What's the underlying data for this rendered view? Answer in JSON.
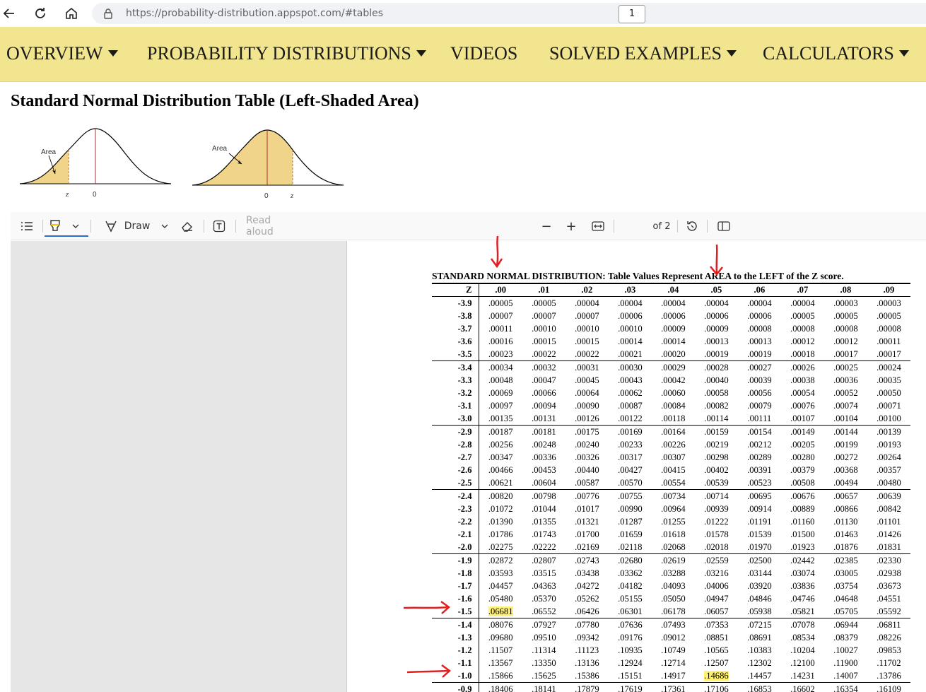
{
  "browser": {
    "url": "https://probability-distribution.appspot.com/#tables",
    "icons": {
      "back": "back-arrow-icon",
      "reload": "reload-icon",
      "home": "home-icon",
      "lock": "lock-icon"
    }
  },
  "nav": {
    "items": [
      {
        "label": "OVERVIEW",
        "dropdown": true
      },
      {
        "label": "PROBABILITY DISTRIBUTIONS",
        "dropdown": true
      },
      {
        "label": "VIDEOS",
        "dropdown": false
      },
      {
        "label": "SOLVED EXAMPLES",
        "dropdown": true
      },
      {
        "label": "CALCULATORS",
        "dropdown": true
      }
    ],
    "bg_color": "#f2e58f"
  },
  "page": {
    "title": "Standard Normal Distribution Table (Left-Shaded Area)"
  },
  "curves": {
    "left": {
      "area_label": "Area",
      "z_label": "z",
      "zero_label": "0"
    },
    "right": {
      "area_label": "Area",
      "z_label": "z",
      "zero_label": "0"
    },
    "fill_color": "#f0d48a"
  },
  "pdf_toolbar": {
    "draw_label": "Draw",
    "read_aloud_label": "Read aloud",
    "page_current": "1",
    "page_total": "of 2",
    "zoom_out": "−",
    "zoom_in": "+"
  },
  "table": {
    "title": "STANDARD NORMAL DISTRIBUTION: Table Values Represent AREA to the LEFT of the Z score.",
    "header": [
      "Z",
      ".00",
      ".01",
      ".02",
      ".03",
      ".04",
      ".05",
      ".06",
      ".07",
      ".08",
      ".09"
    ],
    "rows": [
      [
        "-3.9",
        ".00005",
        ".00005",
        ".00004",
        ".00004",
        ".00004",
        ".00004",
        ".00004",
        ".00004",
        ".00003",
        ".00003"
      ],
      [
        "-3.8",
        ".00007",
        ".00007",
        ".00007",
        ".00006",
        ".00006",
        ".00006",
        ".00006",
        ".00005",
        ".00005",
        ".00005"
      ],
      [
        "-3.7",
        ".00011",
        ".00010",
        ".00010",
        ".00010",
        ".00009",
        ".00009",
        ".00008",
        ".00008",
        ".00008",
        ".00008"
      ],
      [
        "-3.6",
        ".00016",
        ".00015",
        ".00015",
        ".00014",
        ".00014",
        ".00013",
        ".00013",
        ".00012",
        ".00012",
        ".00011"
      ],
      [
        "-3.5",
        ".00023",
        ".00022",
        ".00022",
        ".00021",
        ".00020",
        ".00019",
        ".00019",
        ".00018",
        ".00017",
        ".00017"
      ],
      [
        "-3.4",
        ".00034",
        ".00032",
        ".00031",
        ".00030",
        ".00029",
        ".00028",
        ".00027",
        ".00026",
        ".00025",
        ".00024"
      ],
      [
        "-3.3",
        ".00048",
        ".00047",
        ".00045",
        ".00043",
        ".00042",
        ".00040",
        ".00039",
        ".00038",
        ".00036",
        ".00035"
      ],
      [
        "-3.2",
        ".00069",
        ".00066",
        ".00064",
        ".00062",
        ".00060",
        ".00058",
        ".00056",
        ".00054",
        ".00052",
        ".00050"
      ],
      [
        "-3.1",
        ".00097",
        ".00094",
        ".00090",
        ".00087",
        ".00084",
        ".00082",
        ".00079",
        ".00076",
        ".00074",
        ".00071"
      ],
      [
        "-3.0",
        ".00135",
        ".00131",
        ".00126",
        ".00122",
        ".00118",
        ".00114",
        ".00111",
        ".00107",
        ".00104",
        ".00100"
      ],
      [
        "-2.9",
        ".00187",
        ".00181",
        ".00175",
        ".00169",
        ".00164",
        ".00159",
        ".00154",
        ".00149",
        ".00144",
        ".00139"
      ],
      [
        "-2.8",
        ".00256",
        ".00248",
        ".00240",
        ".00233",
        ".00226",
        ".00219",
        ".00212",
        ".00205",
        ".00199",
        ".00193"
      ],
      [
        "-2.7",
        ".00347",
        ".00336",
        ".00326",
        ".00317",
        ".00307",
        ".00298",
        ".00289",
        ".00280",
        ".00272",
        ".00264"
      ],
      [
        "-2.6",
        ".00466",
        ".00453",
        ".00440",
        ".00427",
        ".00415",
        ".00402",
        ".00391",
        ".00379",
        ".00368",
        ".00357"
      ],
      [
        "-2.5",
        ".00621",
        ".00604",
        ".00587",
        ".00570",
        ".00554",
        ".00539",
        ".00523",
        ".00508",
        ".00494",
        ".00480"
      ],
      [
        "-2.4",
        ".00820",
        ".00798",
        ".00776",
        ".00755",
        ".00734",
        ".00714",
        ".00695",
        ".00676",
        ".00657",
        ".00639"
      ],
      [
        "-2.3",
        ".01072",
        ".01044",
        ".01017",
        ".00990",
        ".00964",
        ".00939",
        ".00914",
        ".00889",
        ".00866",
        ".00842"
      ],
      [
        "-2.2",
        ".01390",
        ".01355",
        ".01321",
        ".01287",
        ".01255",
        ".01222",
        ".01191",
        ".01160",
        ".01130",
        ".01101"
      ],
      [
        "-2.1",
        ".01786",
        ".01743",
        ".01700",
        ".01659",
        ".01618",
        ".01578",
        ".01539",
        ".01500",
        ".01463",
        ".01426"
      ],
      [
        "-2.0",
        ".02275",
        ".02222",
        ".02169",
        ".02118",
        ".02068",
        ".02018",
        ".01970",
        ".01923",
        ".01876",
        ".01831"
      ],
      [
        "-1.9",
        ".02872",
        ".02807",
        ".02743",
        ".02680",
        ".02619",
        ".02559",
        ".02500",
        ".02442",
        ".02385",
        ".02330"
      ],
      [
        "-1.8",
        ".03593",
        ".03515",
        ".03438",
        ".03362",
        ".03288",
        ".03216",
        ".03144",
        ".03074",
        ".03005",
        ".02938"
      ],
      [
        "-1.7",
        ".04457",
        ".04363",
        ".04272",
        ".04182",
        ".04093",
        ".04006",
        ".03920",
        ".03836",
        ".03754",
        ".03673"
      ],
      [
        "-1.6",
        ".05480",
        ".05370",
        ".05262",
        ".05155",
        ".05050",
        ".04947",
        ".04846",
        ".04746",
        ".04648",
        ".04551"
      ],
      [
        "-1.5",
        ".06681",
        ".06552",
        ".06426",
        ".06301",
        ".06178",
        ".06057",
        ".05938",
        ".05821",
        ".05705",
        ".05592"
      ],
      [
        "-1.4",
        ".08076",
        ".07927",
        ".07780",
        ".07636",
        ".07493",
        ".07353",
        ".07215",
        ".07078",
        ".06944",
        ".06811"
      ],
      [
        "-1.3",
        ".09680",
        ".09510",
        ".09342",
        ".09176",
        ".09012",
        ".08851",
        ".08691",
        ".08534",
        ".08379",
        ".08226"
      ],
      [
        "-1.2",
        ".11507",
        ".11314",
        ".11123",
        ".10935",
        ".10749",
        ".10565",
        ".10383",
        ".10204",
        ".10027",
        ".09853"
      ],
      [
        "-1.1",
        ".13567",
        ".13350",
        ".13136",
        ".12924",
        ".12714",
        ".12507",
        ".12302",
        ".12100",
        ".11900",
        ".11702"
      ],
      [
        "-1.0",
        ".15866",
        ".15625",
        ".15386",
        ".15151",
        ".14917",
        ".14686",
        ".14457",
        ".14231",
        ".14007",
        ".13786"
      ],
      [
        "-0.9",
        ".18406",
        ".18141",
        ".17879",
        ".17619",
        ".17361",
        ".17106",
        ".16853",
        ".16602",
        ".16354",
        ".16109"
      ]
    ],
    "highlighted_cells": [
      {
        "row": "-1.5",
        "col": ".00",
        "value": ".06681"
      },
      {
        "row": "-1.0",
        "col": ".05",
        "value": ".14686"
      }
    ],
    "highlight_color": "#fff176"
  },
  "annotations": {
    "color": "#e02020",
    "arrows": [
      {
        "kind": "down",
        "target_col": ".00"
      },
      {
        "kind": "down",
        "target_col": ".05"
      },
      {
        "kind": "right",
        "target_row": "-1.5"
      },
      {
        "kind": "right",
        "target_row": "-1.0"
      }
    ]
  }
}
